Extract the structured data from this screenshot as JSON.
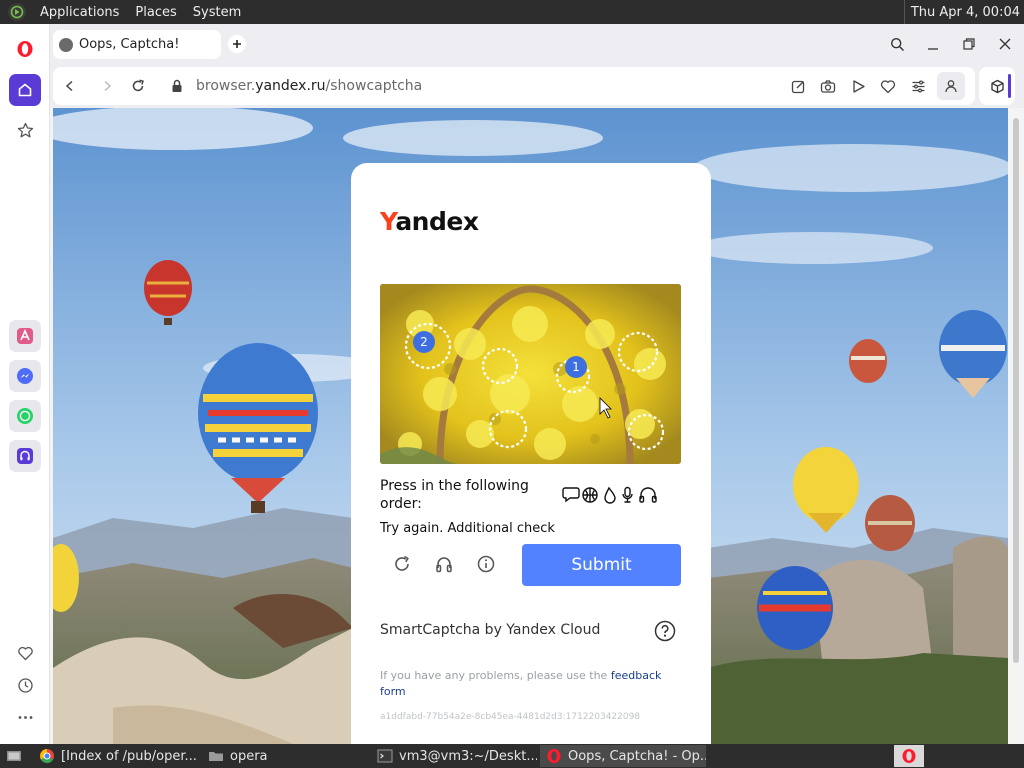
{
  "system_bar": {
    "menus": [
      "Applications",
      "Places",
      "System"
    ],
    "clock": "Thu Apr  4, 00:04"
  },
  "browser": {
    "tab_title": "Oops, Captcha!",
    "url_prefix": "browser.",
    "url_domain": "yandex.ru",
    "url_path": "/showcaptcha"
  },
  "captcha": {
    "logo_first": "Y",
    "logo_rest": "andex",
    "instruction": "Press in the following order:",
    "icon_sequence": [
      "speech-bubble-icon",
      "globe-icon",
      "drop-icon",
      "microphone-icon",
      "headphones-icon"
    ],
    "error": "Try again. Additional check",
    "submit_label": "Submit",
    "image_markers": [
      "2",
      "1"
    ],
    "footer_brand": "SmartCaptcha by Yandex Cloud",
    "feedback_text": "If you have any problems, please use the ",
    "feedback_link": "feedback form",
    "captcha_id": "a1ddfabd-77b54a2e-8cb45ea-4481d2d3:1712203422098"
  },
  "taskbar": {
    "items": [
      "[Index of /pub/oper...",
      "opera",
      "vm3@vm3:~/Deskt...",
      "Oops, Captcha! - Op..."
    ]
  },
  "colors": {
    "accent": "#5282ff",
    "yandex_red": "#fc3f1d",
    "opera_red": "#ff1b2d",
    "sidebar_active": "#5b3bd6"
  }
}
